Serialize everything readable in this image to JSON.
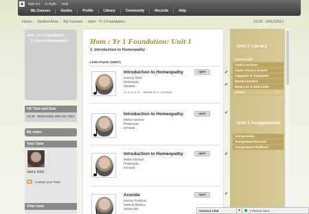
{
  "topnav": {
    "row1": [
      "Sign out",
      "In-Sight",
      "Help"
    ],
    "row2": [
      "My Courses",
      "Guides",
      "Profile",
      "Library",
      "Community",
      "Records",
      "Help"
    ]
  },
  "breadcrumb": [
    "Home",
    "Student Area",
    "My Courses",
    "Hom : Yr 1 Foundation"
  ],
  "timestamp": "13:39 : 19/12/2012",
  "left": {
    "course_tree": [
      "Hom : Yr 1 Foundation",
      "1: Intro to Homeopathy"
    ],
    "uk_time_head": "UK Time and Date",
    "uk_time_value": "13.39 - Wednesday 19th Dec 2012",
    "my_notes": "My notes",
    "tutor_head": "Your Tutor",
    "tutor_name": "Jenny Grist",
    "contact_tutor": "Contact your Tutor",
    "chatroom_head": "Chat room"
  },
  "main": {
    "title": "Hom : Yr 1 Foundation: Unit 1",
    "subtitle": "1: Introduction to Homeopathy",
    "author": "Linda Frazier (16537)",
    "items": [
      {
        "title": "Introduction to Homeopathy",
        "line1": "Jeremy Sherr",
        "line2": "Philosophy",
        "line3": "33m28s",
        "open": "open",
        "rating_text": "Based on 1 comment"
      },
      {
        "title": "Introduction to Homeopathy",
        "line1": "Misha Norland",
        "line2": "Philosophy",
        "line3": "27m03s",
        "open": "open"
      },
      {
        "title": "Introduction to Homeopathy",
        "line1": "Misha Norland",
        "line2": "Philosophy",
        "line3": "44m43s",
        "open": "open"
      },
      {
        "title": "Aconite",
        "line1": "Murray Feldman",
        "line2": "Materia Medica",
        "line3": "1h02m18s",
        "open": "open"
      }
    ]
  },
  "right": {
    "library_title": "Unit 1 Library",
    "library_items": [
      "Course Unit",
      "Audio Lectures",
      "Audio Visual Lectures",
      "Diagrams & Templates",
      "Model Answers",
      "Book List & Web Links",
      "Forum"
    ],
    "assignments_title": "Unit 1 Assignments",
    "assignment_items": [
      "Assignments",
      "Assignment Records",
      "Assignment Feedback"
    ]
  },
  "chatbar": {
    "label": "General Chat",
    "arrow": "▼",
    "people": "1 Person Here"
  }
}
